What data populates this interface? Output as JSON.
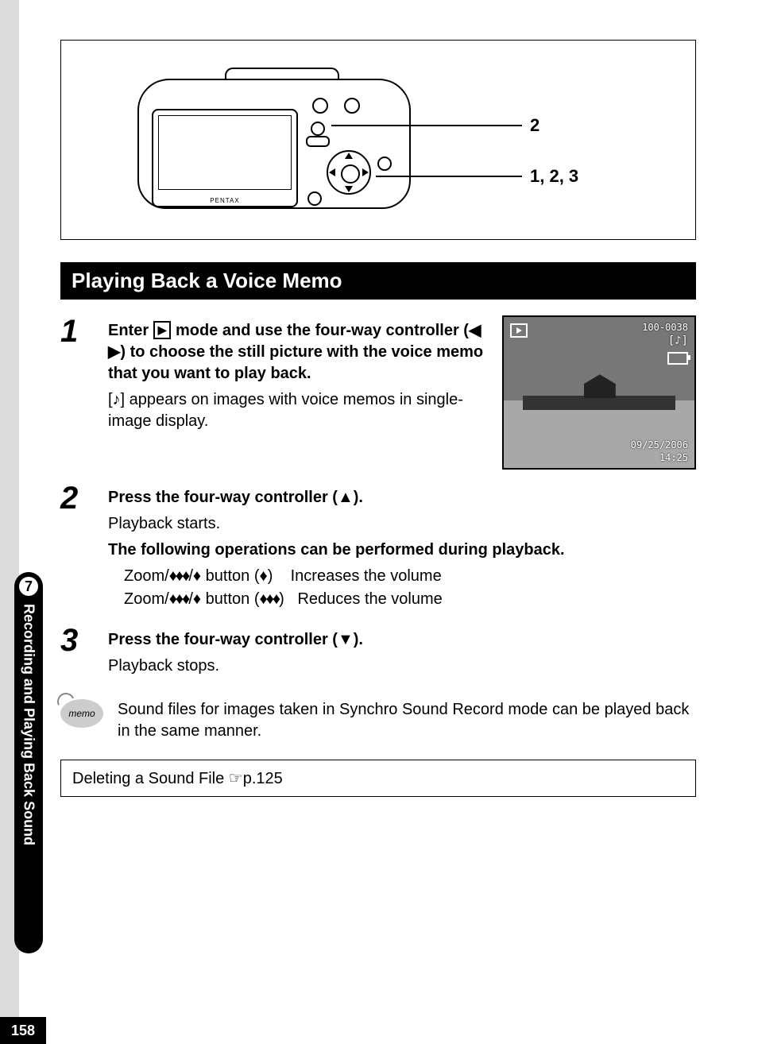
{
  "page_number": "158",
  "tab": {
    "chapter": "7",
    "title": "Recording and Playing Back Sound"
  },
  "illustration": {
    "brand": "PENTAX",
    "callout_top": "2",
    "callout_bottom": "1, 2, 3"
  },
  "heading": "Playing Back a Voice Memo",
  "screen_inset": {
    "file_number": "100-0038",
    "date": "09/25/2006",
    "time": "14:25"
  },
  "steps": [
    {
      "num": "1",
      "title_pre": "Enter ",
      "title_mid": " mode and use the four-way controller (",
      "title_post": ") to choose the still picture with the voice memo that you want to play back.",
      "note": " appears on images with voice memos in single-image display."
    },
    {
      "num": "2",
      "title_pre": "Press the four-way controller (",
      "title_post": ").",
      "line1": "Playback starts.",
      "sub_bold": "The following operations can be performed during playback.",
      "op1_pre": "Zoom/",
      "op1_mid": "/",
      "op1_btn": " button (",
      "op1_close": ")",
      "op1_desc": "Increases the volume",
      "op2_pre": "Zoom/",
      "op2_mid": "/",
      "op2_btn": " button (",
      "op2_close": ")",
      "op2_desc": "Reduces the volume"
    },
    {
      "num": "3",
      "title_pre": "Press the four-way controller (",
      "title_post": ").",
      "line1": "Playback stops."
    }
  ],
  "memo": {
    "label": "memo",
    "text": "Sound files for images taken in Synchro Sound Record mode can be played back in the same manner."
  },
  "xref": {
    "text": "Deleting a Sound File ",
    "page": "p.125"
  },
  "glyphs": {
    "play_box": "▶",
    "left_right": "◀ ▶",
    "up": "▲",
    "down": "▼",
    "sound_icon": "[♪]",
    "zoom_multi": "♦♦♦",
    "zoom_single": "♦",
    "pointer": "☞"
  }
}
